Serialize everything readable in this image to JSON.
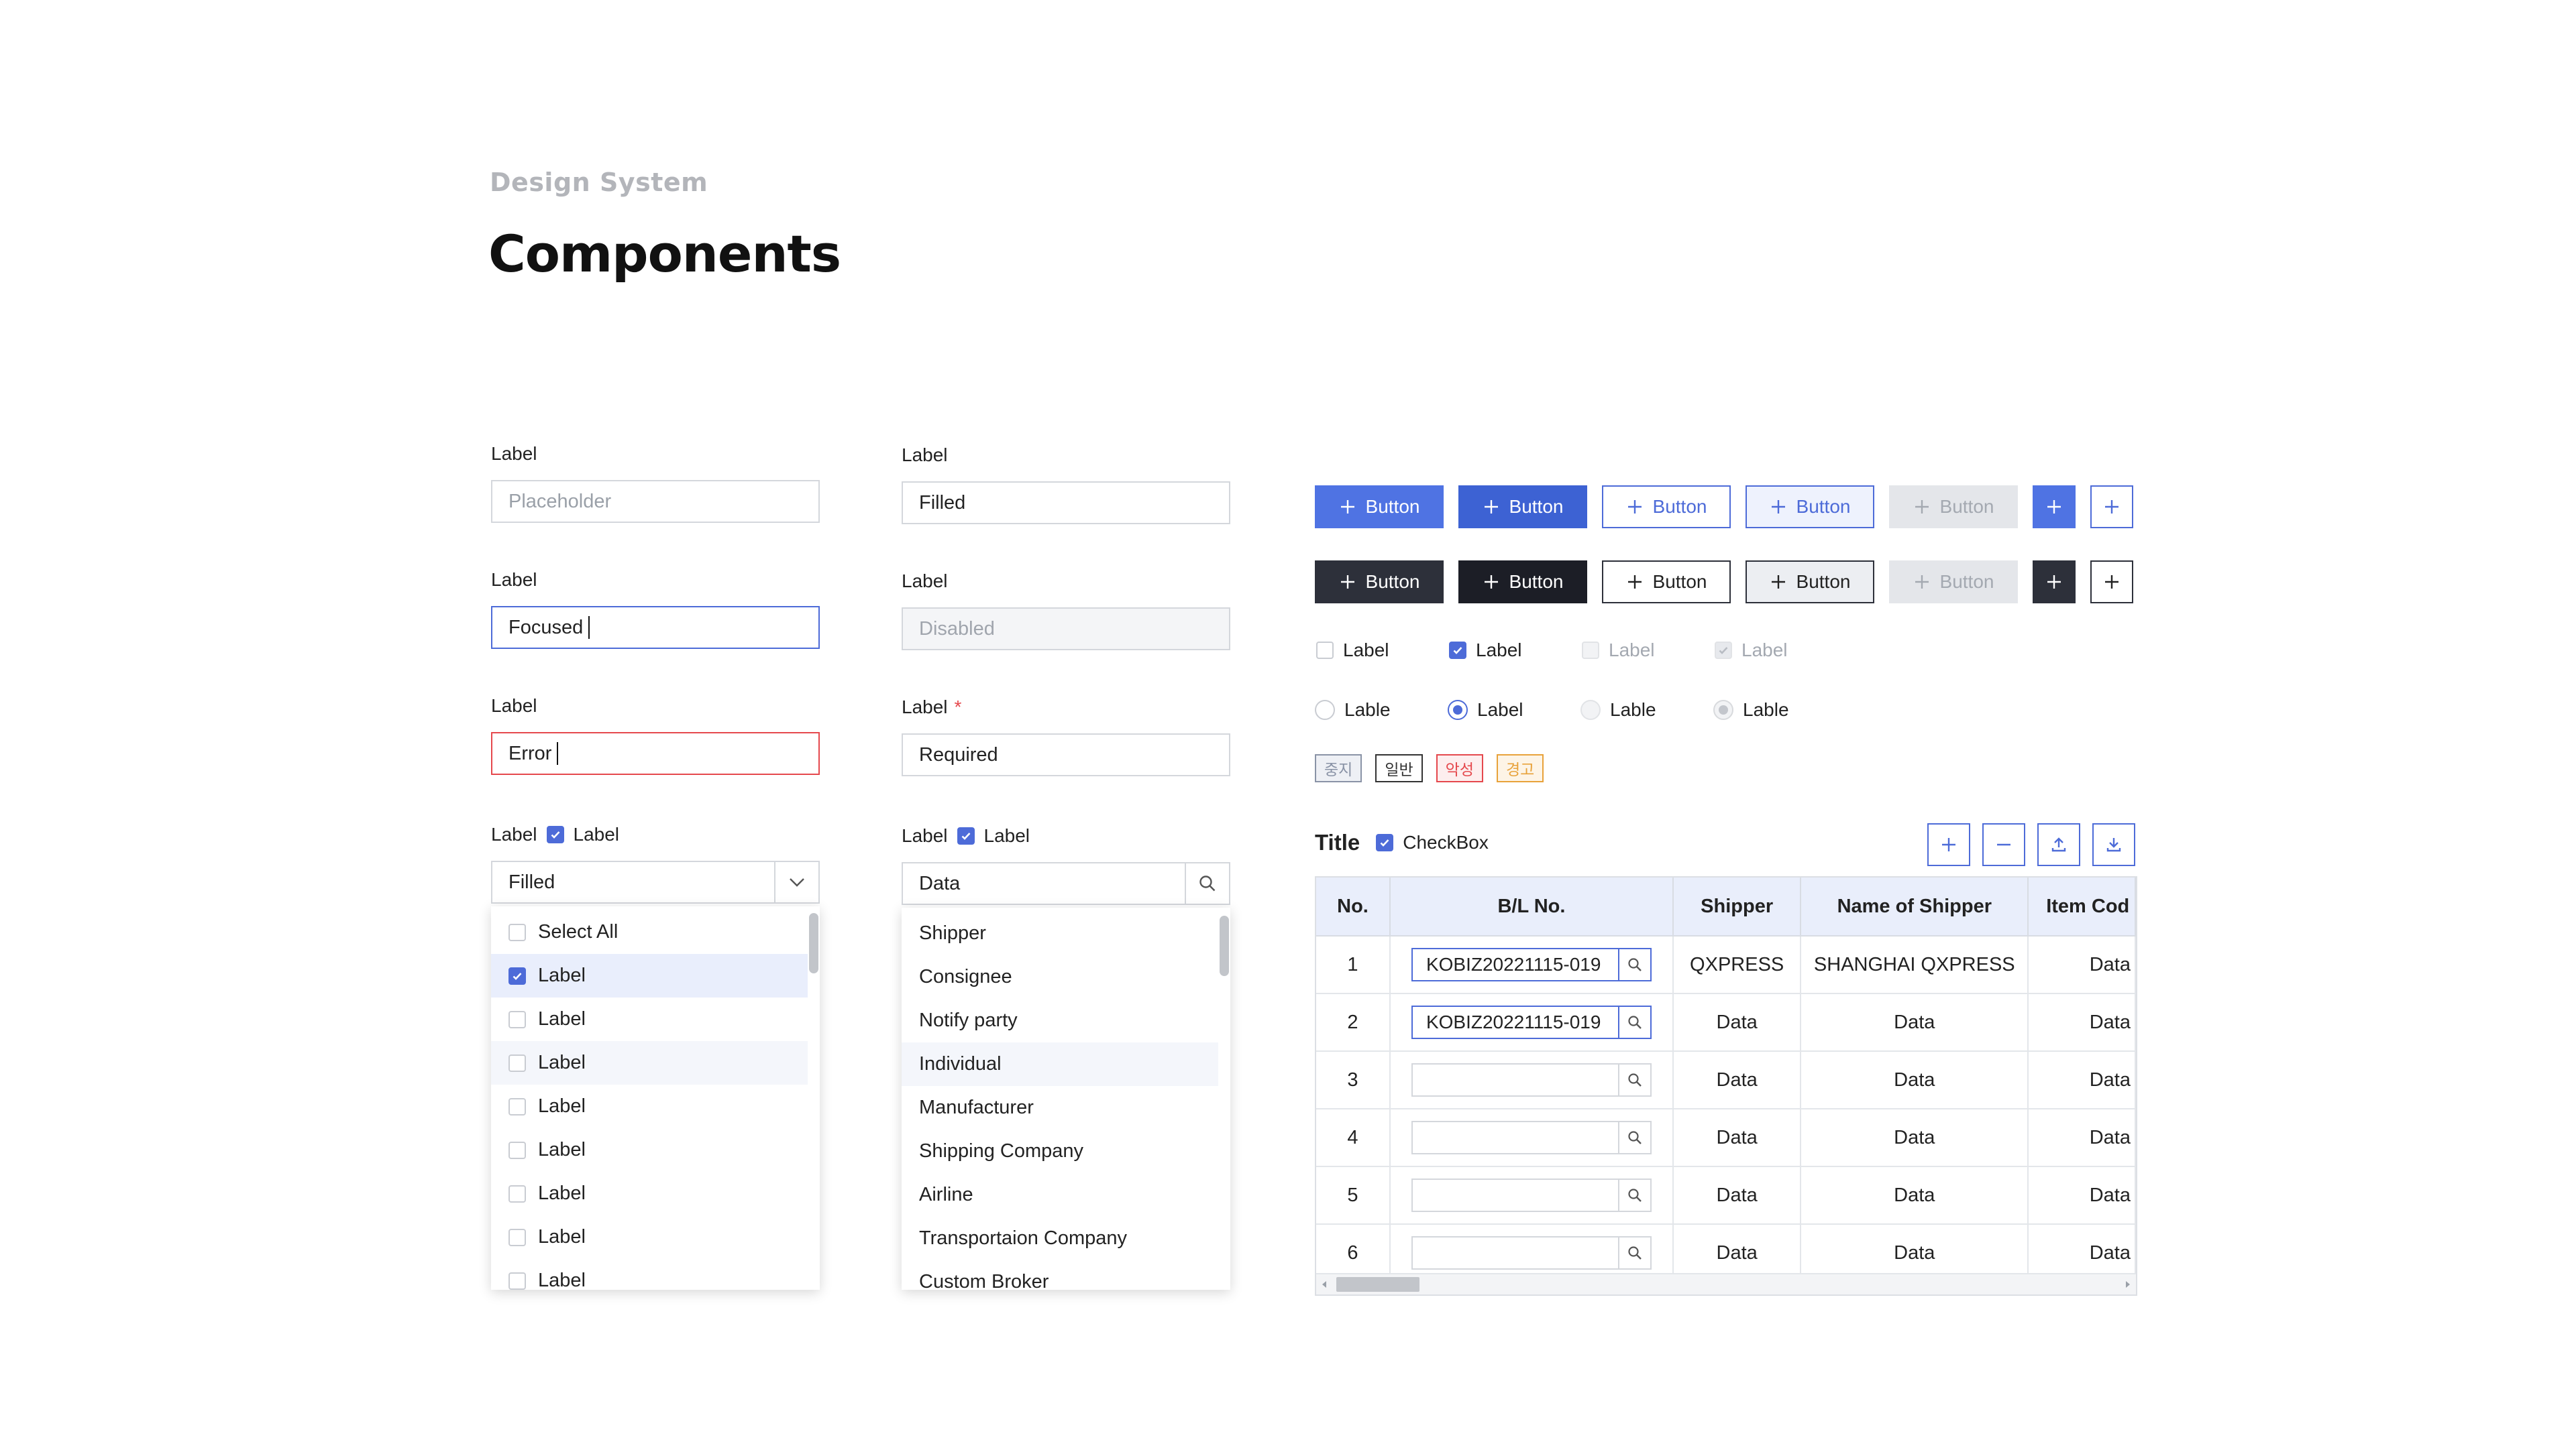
{
  "header": {
    "eyebrow": "Design System",
    "title": "Components"
  },
  "inputs_col1": [
    {
      "label": "Label",
      "value": "Placeholder",
      "state": "placeholder"
    },
    {
      "label": "Label",
      "value": "Focused",
      "state": "focused"
    },
    {
      "label": "Label",
      "value": "Error",
      "state": "error"
    }
  ],
  "inputs_col2": [
    {
      "label": "Label",
      "value": "Filled",
      "state": "filled"
    },
    {
      "label": "Label",
      "value": "Disabled",
      "state": "disabled"
    },
    {
      "label": "Label",
      "value": "Required",
      "state": "required"
    }
  ],
  "multiselect": {
    "label": "Label",
    "checkbox_label": "Label",
    "value": "Filled",
    "items": [
      "Select All",
      "Label",
      "Label",
      "Label",
      "Label",
      "Label",
      "Label",
      "Label",
      "Label"
    ],
    "checked_index": 1,
    "hover_index": 3
  },
  "searchselect": {
    "label": "Label",
    "checkbox_label": "Label",
    "value": "Data",
    "items": [
      "Shipper",
      "Consignee",
      "Notify party",
      "Individual",
      "Manufacturer",
      "Shipping Company",
      "Airline",
      "Transportaion Company",
      "Custom Broker"
    ],
    "hover_index": 3
  },
  "buttons": {
    "label": "Button"
  },
  "checkboxes": [
    "Label",
    "Label",
    "Label",
    "Label"
  ],
  "radios": [
    "Lable",
    "Label",
    "Lable",
    "Lable"
  ],
  "tags": [
    {
      "text": "중지",
      "color": "#8a93a6",
      "bg": "#eef0f5"
    },
    {
      "text": "일반",
      "color": "#333333",
      "bg": "#ffffff"
    },
    {
      "text": "악성",
      "color": "#e5484d",
      "bg": "#fdeeee"
    },
    {
      "text": "경고",
      "color": "#e8a23a",
      "bg": "#fdf4e6"
    }
  ],
  "table": {
    "title": "Title",
    "checkbox_label": "CheckBox",
    "columns": [
      "No.",
      "B/L No.",
      "Shipper",
      "Name of Shipper",
      "Item Cod"
    ],
    "rows": [
      {
        "no": "1",
        "bl": "KOBIZ20221115-019",
        "shipper": "QXPRESS",
        "name": "SHANGHAI QXPRESS",
        "item": "Data"
      },
      {
        "no": "2",
        "bl": "KOBIZ20221115-019",
        "shipper": "Data",
        "name": "Data",
        "item": "Data"
      },
      {
        "no": "3",
        "bl": "",
        "shipper": "Data",
        "name": "Data",
        "item": "Data"
      },
      {
        "no": "4",
        "bl": "",
        "shipper": "Data",
        "name": "Data",
        "item": "Data"
      },
      {
        "no": "5",
        "bl": "",
        "shipper": "Data",
        "name": "Data",
        "item": "Data"
      },
      {
        "no": "6",
        "bl": "",
        "shipper": "Data",
        "name": "Data",
        "item": "Data"
      }
    ]
  },
  "colors": {
    "accent": "#4d6bd8",
    "dark": "#2d303a",
    "error": "#e5484d"
  }
}
